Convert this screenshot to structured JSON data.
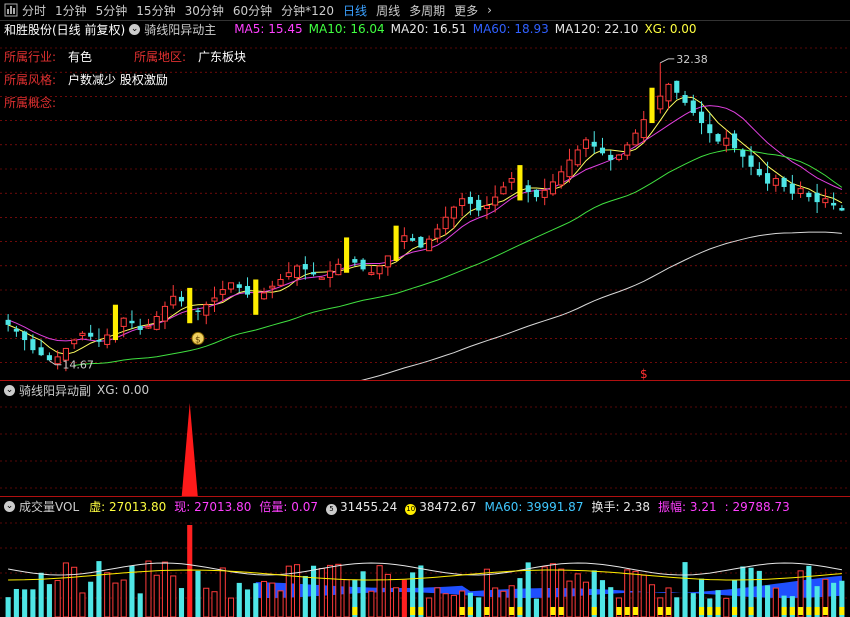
{
  "toolbar": {
    "tabs": [
      "分时",
      "1分钟",
      "5分钟",
      "15分钟",
      "30分钟",
      "60分钟",
      "分钟*120",
      "日线",
      "周线",
      "多周期",
      "更多"
    ],
    "active": "日线"
  },
  "main_panel": {
    "stock": "和胜股份(日线 前复权)",
    "indicator": "骑线阳异动主",
    "ma": [
      {
        "label": "MA5: 15.45",
        "color": "#ff40ff"
      },
      {
        "label": "MA10: 16.04",
        "color": "#40ff40"
      },
      {
        "label": "MA20: 16.51",
        "color": "#e6e6e6"
      },
      {
        "label": "MA60: 18.93",
        "color": "#3060ff"
      },
      {
        "label": "MA120: 22.10",
        "color": "#e6e6e6"
      },
      {
        "label": "XG: 0.00",
        "color": "#ffff40"
      }
    ],
    "info": [
      {
        "key": "所属行业:",
        "value": "有色"
      },
      {
        "key": "所属地区:",
        "value": "广东板块"
      },
      {
        "key": "所属风格:",
        "value": "户数减少 股权激励"
      },
      {
        "key": "所属概念:",
        "value": ""
      }
    ],
    "high_label": "32.38",
    "low_label": "14.67",
    "dollar_mark": "$"
  },
  "sub_panel": {
    "indicator": "骑线阳异动副",
    "xg": "XG: 0.00"
  },
  "vol_panel": {
    "indicator": "成交量VOL",
    "items": [
      {
        "label": "虚: 27013.80",
        "color": "#ffff40"
      },
      {
        "label": "现: 27013.80",
        "color": "#ff40ff"
      },
      {
        "label": "倍量: 0.07",
        "color": "#ff40ff"
      },
      {
        "label": "31455.24",
        "color": "#e6e6e6",
        "icon": "5"
      },
      {
        "label": "38472.67",
        "color": "#e6e6e6",
        "icon": "10"
      },
      {
        "label": "MA60: 39991.87",
        "color": "#40c8ff"
      },
      {
        "label": "换手: 2.38",
        "color": "#e6e6e6"
      },
      {
        "label": "振幅: 3.21",
        "color": "#ff40ff"
      },
      {
        "label": ": 29788.73",
        "color": "#ff40ff"
      }
    ]
  },
  "colors": {
    "up": "#ff3b3b",
    "down": "#4fe6e6",
    "signal": "#ffee00",
    "grid": "#b01010"
  },
  "chart_data": {
    "type": "candlestick",
    "y_range_main": [
      14.0,
      33.5
    ],
    "high": 32.38,
    "low": 14.67,
    "close_path": [
      16.8,
      16.4,
      15.9,
      15.3,
      15.0,
      14.7,
      14.9,
      15.4,
      15.9,
      16.3,
      16.1,
      15.8,
      16.2,
      16.8,
      17.2,
      16.9,
      16.5,
      16.7,
      17.3,
      17.9,
      18.5,
      18.2,
      17.8,
      17.6,
      18.0,
      18.4,
      18.9,
      19.3,
      19.0,
      18.6,
      18.3,
      18.7,
      19.1,
      19.5,
      19.9,
      20.3,
      20.1,
      19.8,
      19.6,
      20.0,
      20.4,
      20.8,
      20.5,
      20.1,
      19.9,
      20.3,
      20.9,
      21.5,
      22.1,
      21.8,
      21.4,
      21.9,
      22.5,
      23.2,
      23.8,
      24.3,
      24.0,
      23.6,
      23.9,
      24.4,
      25.0,
      25.5,
      25.1,
      24.7,
      24.4,
      24.8,
      25.3,
      25.9,
      26.6,
      27.2,
      27.8,
      27.4,
      27.0,
      26.6,
      26.9,
      27.5,
      28.2,
      29.0,
      29.7,
      30.4,
      31.1,
      30.6,
      30.0,
      29.4,
      28.8,
      28.2,
      27.7,
      27.9,
      27.3,
      26.8,
      26.2,
      25.7,
      25.2,
      25.5,
      25.0,
      24.6,
      24.9,
      24.4,
      24.1,
      24.3,
      23.9,
      23.6
    ],
    "signal_days": [
      13,
      22,
      30,
      41,
      47,
      62,
      78
    ],
    "sub_spike_day": 22
  }
}
